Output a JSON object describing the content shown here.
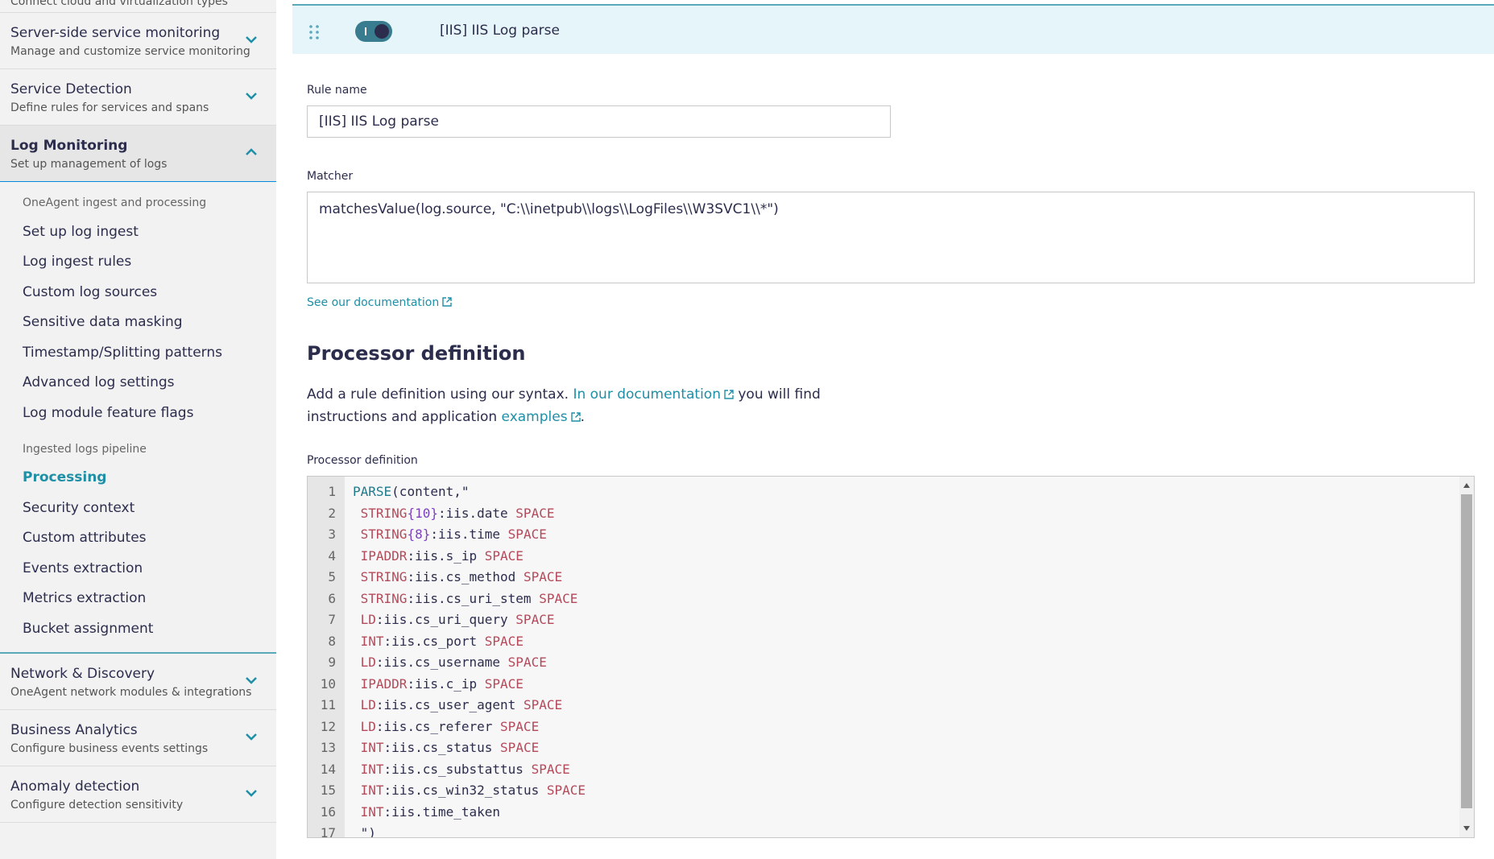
{
  "sidebar": {
    "top_cut": {
      "subtitle": "Connect cloud and virtualization types"
    },
    "sections_before": [
      {
        "title": "Server-side service monitoring",
        "subtitle": "Manage and customize service monitoring"
      },
      {
        "title": "Service Detection",
        "subtitle": "Define rules for services and spans"
      }
    ],
    "expanded": {
      "title": "Log Monitoring",
      "subtitle": "Set up management of logs",
      "group1_label": "OneAgent ingest and processing",
      "group1_items": [
        "Set up log ingest",
        "Log ingest rules",
        "Custom log sources",
        "Sensitive data masking",
        "Timestamp/Splitting patterns",
        "Advanced log settings",
        "Log module feature flags"
      ],
      "group2_label": "Ingested logs pipeline",
      "group2_items": [
        "Processing",
        "Security context",
        "Custom attributes",
        "Events extraction",
        "Metrics extraction",
        "Bucket assignment"
      ]
    },
    "sections_after": [
      {
        "title": "Network & Discovery",
        "subtitle": "OneAgent network modules & integrations"
      },
      {
        "title": "Business Analytics",
        "subtitle": "Configure business events settings"
      },
      {
        "title": "Anomaly detection",
        "subtitle": "Configure detection sensitivity"
      }
    ]
  },
  "rule": {
    "header_title": "[IIS] IIS Log parse",
    "enabled": true,
    "rule_name_label": "Rule name",
    "rule_name_value": "[IIS] IIS Log parse",
    "matcher_label": "Matcher",
    "matcher_value": "matchesValue(log.source, \"C:\\\\inetpub\\\\logs\\\\LogFiles\\\\W3SVC1\\\\*\")",
    "see_doc": "See our documentation"
  },
  "processor": {
    "heading": "Processor definition",
    "desc_pre": "Add a rule definition using our syntax. ",
    "desc_link1": "In our documentation",
    "desc_mid": " you will find instructions and application ",
    "desc_link2": "examples",
    "desc_end": ".",
    "label": "Processor definition",
    "lines": [
      [
        {
          "c": "kw",
          "t": "PARSE"
        },
        {
          "c": "",
          "t": "(content,\""
        }
      ],
      [
        {
          "c": "",
          "t": " "
        },
        {
          "c": "mt",
          "t": "STRING"
        },
        {
          "c": "num",
          "t": "{10}"
        },
        {
          "c": "",
          "t": ":iis.date "
        },
        {
          "c": "mt",
          "t": "SPACE"
        }
      ],
      [
        {
          "c": "",
          "t": " "
        },
        {
          "c": "mt",
          "t": "STRING"
        },
        {
          "c": "num",
          "t": "{8}"
        },
        {
          "c": "",
          "t": ":iis.time "
        },
        {
          "c": "mt",
          "t": "SPACE"
        }
      ],
      [
        {
          "c": "",
          "t": " "
        },
        {
          "c": "mt",
          "t": "IPADDR"
        },
        {
          "c": "",
          "t": ":iis.s_ip "
        },
        {
          "c": "mt",
          "t": "SPACE"
        }
      ],
      [
        {
          "c": "",
          "t": " "
        },
        {
          "c": "mt",
          "t": "STRING"
        },
        {
          "c": "",
          "t": ":iis.cs_method "
        },
        {
          "c": "mt",
          "t": "SPACE"
        }
      ],
      [
        {
          "c": "",
          "t": " "
        },
        {
          "c": "mt",
          "t": "STRING"
        },
        {
          "c": "",
          "t": ":iis.cs_uri_stem "
        },
        {
          "c": "mt",
          "t": "SPACE"
        }
      ],
      [
        {
          "c": "",
          "t": " "
        },
        {
          "c": "mt",
          "t": "LD"
        },
        {
          "c": "",
          "t": ":iis.cs_uri_query "
        },
        {
          "c": "mt",
          "t": "SPACE"
        }
      ],
      [
        {
          "c": "",
          "t": " "
        },
        {
          "c": "mt",
          "t": "INT"
        },
        {
          "c": "",
          "t": ":iis.cs_port "
        },
        {
          "c": "mt",
          "t": "SPACE"
        }
      ],
      [
        {
          "c": "",
          "t": " "
        },
        {
          "c": "mt",
          "t": "LD"
        },
        {
          "c": "",
          "t": ":iis.cs_username "
        },
        {
          "c": "mt",
          "t": "SPACE"
        }
      ],
      [
        {
          "c": "",
          "t": " "
        },
        {
          "c": "mt",
          "t": "IPADDR"
        },
        {
          "c": "",
          "t": ":iis.c_ip "
        },
        {
          "c": "mt",
          "t": "SPACE"
        }
      ],
      [
        {
          "c": "",
          "t": " "
        },
        {
          "c": "mt",
          "t": "LD"
        },
        {
          "c": "",
          "t": ":iis.cs_user_agent "
        },
        {
          "c": "mt",
          "t": "SPACE"
        }
      ],
      [
        {
          "c": "",
          "t": " "
        },
        {
          "c": "mt",
          "t": "LD"
        },
        {
          "c": "",
          "t": ":iis.cs_referer "
        },
        {
          "c": "mt",
          "t": "SPACE"
        }
      ],
      [
        {
          "c": "",
          "t": " "
        },
        {
          "c": "mt",
          "t": "INT"
        },
        {
          "c": "",
          "t": ":iis.cs_status "
        },
        {
          "c": "mt",
          "t": "SPACE"
        }
      ],
      [
        {
          "c": "",
          "t": " "
        },
        {
          "c": "mt",
          "t": "INT"
        },
        {
          "c": "",
          "t": ":iis.cs_substattus "
        },
        {
          "c": "mt",
          "t": "SPACE"
        }
      ],
      [
        {
          "c": "",
          "t": " "
        },
        {
          "c": "mt",
          "t": "INT"
        },
        {
          "c": "",
          "t": ":iis.cs_win32_status "
        },
        {
          "c": "mt",
          "t": "SPACE"
        }
      ],
      [
        {
          "c": "",
          "t": " "
        },
        {
          "c": "mt",
          "t": "INT"
        },
        {
          "c": "",
          "t": ":iis.time_taken"
        }
      ],
      [
        {
          "c": "",
          "t": " \")"
        }
      ]
    ]
  },
  "icons": {
    "chevron": "chevron-down-icon",
    "external": "external-link-icon",
    "drag": "drag-handle-icon"
  },
  "colors": {
    "accent": "#1f8fa6",
    "keyword": "#1f7a8c",
    "matcher": "#b4495a",
    "number": "#7c3fbf"
  }
}
